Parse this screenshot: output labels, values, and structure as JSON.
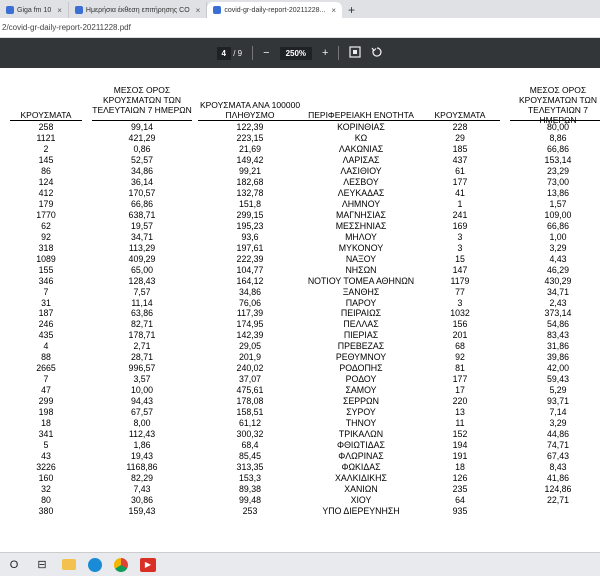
{
  "browser": {
    "tabs": [
      {
        "label": "Giga fm 10",
        "active": false,
        "color": "#3b6fd4"
      },
      {
        "label": "Ημερήσια έκθεση επιτήρησης CO",
        "active": false,
        "color": "#3b6fd4"
      },
      {
        "label": "covid-gr-daily-report-20211228...",
        "active": true,
        "color": "#3b6fd4"
      }
    ],
    "new_tab_label": "+",
    "address": "2/covid-gr-daily-report-20211228.pdf"
  },
  "pdf_toolbar": {
    "page_current": "4",
    "page_separator": "/",
    "page_total": "9",
    "zoom_out": "−",
    "zoom": "250%",
    "zoom_in": "+"
  },
  "table": {
    "headers": [
      "ΚΡΟΥΣΜΑΤΑ",
      "ΜΕΣΟΣ ΟΡΟΣ\nΚΡΟΥΣΜΑΤΩΝ ΤΩΝ\nΤΕΛΕΥΤΑΙΩΝ 7 ΗΜΕΡΩΝ",
      "ΚΡΟΥΣΜΑΤΑ ΑΝΑ 100000\nΠΛΗΘΥΣΜΟ",
      "ΠΕΡΙΦΕΡΕΙΑΚΗ ΕΝΟΤΗΤΑ",
      "ΚΡΟΥΣΜΑΤΑ",
      "ΜΕΣΟΣ ΟΡΟΣ\nΚΡΟΥΣΜΑΤΩΝ ΤΩΝ\nΤΕΛΕΥΤΑΙΩΝ 7 ΗΜΕΡΩΝ"
    ],
    "rows": [
      [
        "258",
        "99,14",
        "122,39",
        "ΚΟΡΙΝΘΙΑΣ",
        "228",
        "80,00"
      ],
      [
        "1121",
        "421,29",
        "223,15",
        "ΚΩ",
        "29",
        "8,86"
      ],
      [
        "2",
        "0,86",
        "21,69",
        "ΛΑΚΩΝΙΑΣ",
        "185",
        "66,86"
      ],
      [
        "145",
        "52,57",
        "149,42",
        "ΛΑΡΙΣΑΣ",
        "437",
        "153,14"
      ],
      [
        "86",
        "34,86",
        "99,21",
        "ΛΑΣΙΘΙΟΥ",
        "61",
        "23,29"
      ],
      [
        "124",
        "36,14",
        "182,68",
        "ΛΕΣΒΟΥ",
        "177",
        "73,00"
      ],
      [
        "412",
        "170,57",
        "132,78",
        "ΛΕΥΚΑΔΑΣ",
        "41",
        "13,86"
      ],
      [
        "179",
        "66,86",
        "151,8",
        "ΛΗΜΝΟΥ",
        "1",
        "1,57"
      ],
      [
        "1770",
        "638,71",
        "299,15",
        "ΜΑΓΝΗΣΙΑΣ",
        "241",
        "109,00"
      ],
      [
        "62",
        "19,57",
        "195,23",
        "ΜΕΣΣΗΝΙΑΣ",
        "169",
        "66,86"
      ],
      [
        "92",
        "34,71",
        "93,6",
        "ΜΗΛΟΥ",
        "3",
        "1,00"
      ],
      [
        "318",
        "113,29",
        "197,61",
        "ΜΥΚΟΝΟΥ",
        "3",
        "3,29"
      ],
      [
        "1089",
        "409,29",
        "222,39",
        "ΝΑΞΟΥ",
        "15",
        "4,43"
      ],
      [
        "155",
        "65,00",
        "104,77",
        "ΝΗΣΩΝ",
        "147",
        "46,29"
      ],
      [
        "346",
        "128,43",
        "164,12",
        "ΝΟΤΙΟΥ ΤΟΜΕΑ ΑΘΗΝΩΝ",
        "1179",
        "430,29"
      ],
      [
        "7",
        "7,57",
        "34,86",
        "ΞΑΝΘΗΣ",
        "77",
        "34,71"
      ],
      [
        "31",
        "11,14",
        "76,06",
        "ΠΑΡΟΥ",
        "3",
        "2,43"
      ],
      [
        "187",
        "63,86",
        "117,39",
        "ΠΕΙΡΑΙΩΣ",
        "1032",
        "373,14"
      ],
      [
        "246",
        "82,71",
        "174,95",
        "ΠΕΛΛΑΣ",
        "156",
        "54,86"
      ],
      [
        "435",
        "178,71",
        "142,39",
        "ΠΙΕΡΙΑΣ",
        "201",
        "83,43"
      ],
      [
        "4",
        "2,71",
        "29,05",
        "ΠΡΕΒΕΖΑΣ",
        "68",
        "31,86"
      ],
      [
        "88",
        "28,71",
        "201,9",
        "ΡΕΘΥΜΝΟΥ",
        "92",
        "39,86"
      ],
      [
        "2665",
        "996,57",
        "240,02",
        "ΡΟΔΟΠΗΣ",
        "81",
        "42,00"
      ],
      [
        "7",
        "3,57",
        "37,07",
        "ΡΟΔΟΥ",
        "177",
        "59,43"
      ],
      [
        "47",
        "10,00",
        "475,61",
        "ΣΑΜΟΥ",
        "17",
        "5,29"
      ],
      [
        "299",
        "94,43",
        "178,08",
        "ΣΕΡΡΩΝ",
        "220",
        "93,71"
      ],
      [
        "198",
        "67,57",
        "158,51",
        "ΣΥΡΟΥ",
        "13",
        "7,14"
      ],
      [
        "18",
        "8,00",
        "61,12",
        "ΤΗΝΟΥ",
        "11",
        "3,29"
      ],
      [
        "341",
        "112,43",
        "300,32",
        "ΤΡΙΚΑΛΩΝ",
        "152",
        "44,86"
      ],
      [
        "5",
        "1,86",
        "68,4",
        "ΦΘΙΩΤΙΔΑΣ",
        "194",
        "74,71"
      ],
      [
        "43",
        "19,43",
        "85,45",
        "ΦΛΩΡΙΝΑΣ",
        "191",
        "67,43"
      ],
      [
        "3226",
        "1168,86",
        "313,35",
        "ΦΩΚΙΔΑΣ",
        "18",
        "8,43"
      ],
      [
        "160",
        "82,29",
        "153,3",
        "ΧΑΛΚΙΔΙΚΗΣ",
        "126",
        "41,86"
      ],
      [
        "32",
        "7,43",
        "89,38",
        "ΧΑΝΙΩΝ",
        "235",
        "124,86"
      ],
      [
        "80",
        "30,86",
        "99,48",
        "ΧΙΟΥ",
        "64",
        "22,71"
      ],
      [
        "380",
        "159,43",
        "253",
        "ΥΠΟ ΔΙΕΡΕΥΝΗΣΗ",
        "935",
        ""
      ]
    ]
  },
  "taskbar": {
    "start_icon": "O",
    "task_view_icon": "⊟"
  }
}
